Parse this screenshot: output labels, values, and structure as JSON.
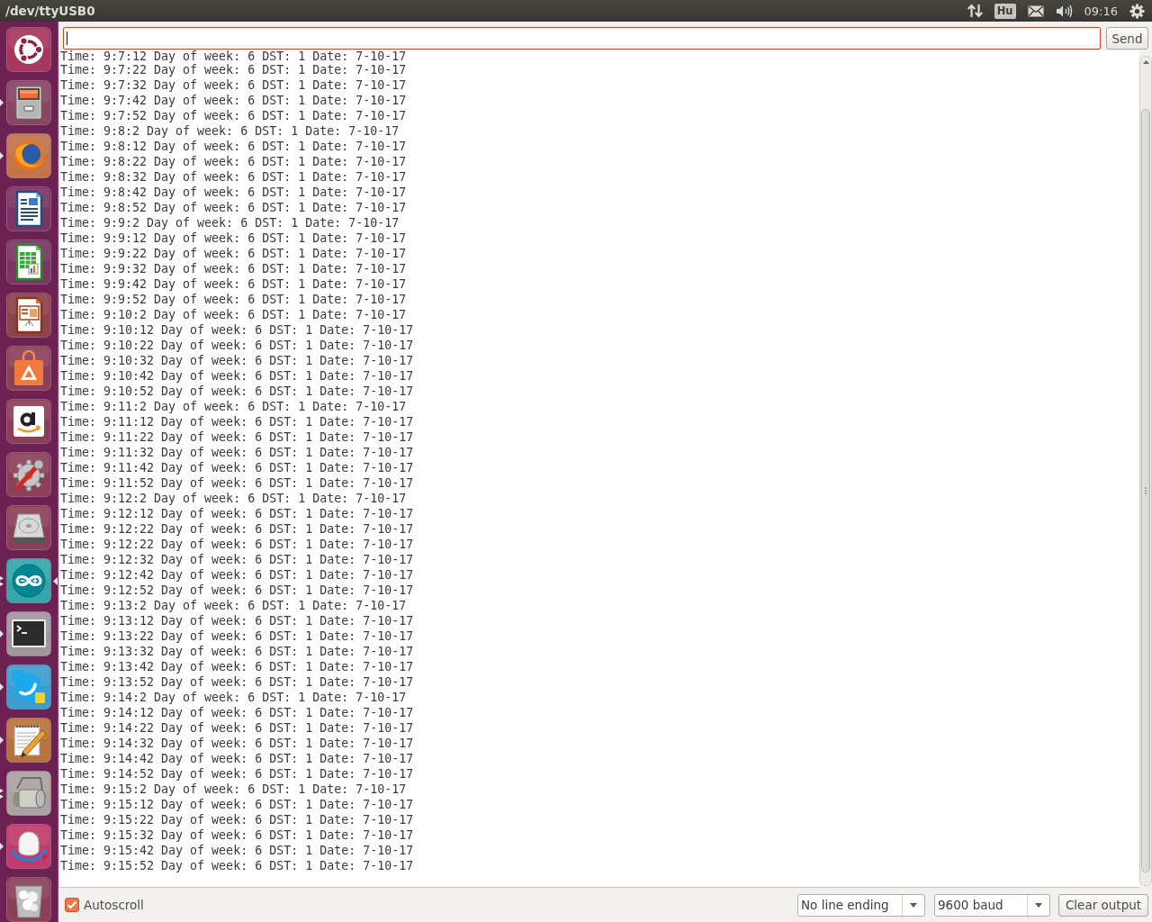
{
  "top_panel": {
    "title": "/dev/ttyUSB0",
    "keyboard_layout": "Hu",
    "clock": "09:16"
  },
  "launcher": {
    "items": [
      {
        "kind": "logo",
        "running": false,
        "multiple_windows": false,
        "focused": false
      },
      {
        "kind": "cabinet",
        "running": true,
        "multiple_windows": false,
        "focused": false
      },
      {
        "kind": "globe",
        "running": true,
        "multiple_windows": false,
        "focused": false
      },
      {
        "kind": "document",
        "running": false,
        "multiple_windows": false,
        "focused": false
      },
      {
        "kind": "spreadsheet",
        "running": false,
        "multiple_windows": false,
        "focused": false
      },
      {
        "kind": "presentation",
        "running": false,
        "multiple_windows": false,
        "focused": false
      },
      {
        "kind": "bag",
        "running": false,
        "multiple_windows": false,
        "focused": false
      },
      {
        "kind": "smile",
        "running": false,
        "multiple_windows": false,
        "focused": false
      },
      {
        "kind": "gear",
        "running": false,
        "multiple_windows": false,
        "focused": false
      },
      {
        "kind": "disk",
        "running": false,
        "multiple_windows": false,
        "focused": false
      },
      {
        "kind": "infinity",
        "running": true,
        "multiple_windows": true,
        "focused": true
      },
      {
        "kind": "terminal",
        "running": true,
        "multiple_windows": false,
        "focused": false
      },
      {
        "kind": "cloud",
        "running": true,
        "multiple_windows": false,
        "focused": false
      },
      {
        "kind": "notepad",
        "running": true,
        "multiple_windows": false,
        "focused": false
      },
      {
        "kind": "roller",
        "running": true,
        "multiple_windows": true,
        "focused": false
      },
      {
        "kind": "dome",
        "running": true,
        "multiple_windows": false,
        "focused": false
      },
      {
        "kind": "trash",
        "running": false,
        "multiple_windows": false,
        "focused": false
      }
    ]
  },
  "send_bar": {
    "message_field": {
      "focused": true
    },
    "send_button": "Send"
  },
  "output": {
    "lines": [
      "Time: 9:7:12 Day of week: 6 DST: 1 Date: 7-10-17",
      "Time: 9:7:22 Day of week: 6 DST: 1 Date: 7-10-17",
      "Time: 9:7:32 Day of week: 6 DST: 1 Date: 7-10-17",
      "Time: 9:7:42 Day of week: 6 DST: 1 Date: 7-10-17",
      "Time: 9:7:52 Day of week: 6 DST: 1 Date: 7-10-17",
      "Time: 9:8:2 Day of week: 6 DST: 1 Date: 7-10-17",
      "Time: 9:8:12 Day of week: 6 DST: 1 Date: 7-10-17",
      "Time: 9:8:22 Day of week: 6 DST: 1 Date: 7-10-17",
      "Time: 9:8:32 Day of week: 6 DST: 1 Date: 7-10-17",
      "Time: 9:8:42 Day of week: 6 DST: 1 Date: 7-10-17",
      "Time: 9:8:52 Day of week: 6 DST: 1 Date: 7-10-17",
      "Time: 9:9:2 Day of week: 6 DST: 1 Date: 7-10-17",
      "Time: 9:9:12 Day of week: 6 DST: 1 Date: 7-10-17",
      "Time: 9:9:22 Day of week: 6 DST: 1 Date: 7-10-17",
      "Time: 9:9:32 Day of week: 6 DST: 1 Date: 7-10-17",
      "Time: 9:9:42 Day of week: 6 DST: 1 Date: 7-10-17",
      "Time: 9:9:52 Day of week: 6 DST: 1 Date: 7-10-17",
      "Time: 9:10:2 Day of week: 6 DST: 1 Date: 7-10-17",
      "Time: 9:10:12 Day of week: 6 DST: 1 Date: 7-10-17",
      "Time: 9:10:22 Day of week: 6 DST: 1 Date: 7-10-17",
      "Time: 9:10:32 Day of week: 6 DST: 1 Date: 7-10-17",
      "Time: 9:10:42 Day of week: 6 DST: 1 Date: 7-10-17",
      "Time: 9:10:52 Day of week: 6 DST: 1 Date: 7-10-17",
      "Time: 9:11:2 Day of week: 6 DST: 1 Date: 7-10-17",
      "Time: 9:11:12 Day of week: 6 DST: 1 Date: 7-10-17",
      "Time: 9:11:22 Day of week: 6 DST: 1 Date: 7-10-17",
      "Time: 9:11:32 Day of week: 6 DST: 1 Date: 7-10-17",
      "Time: 9:11:42 Day of week: 6 DST: 1 Date: 7-10-17",
      "Time: 9:11:52 Day of week: 6 DST: 1 Date: 7-10-17",
      "Time: 9:12:2 Day of week: 6 DST: 1 Date: 7-10-17",
      "Time: 9:12:12 Day of week: 6 DST: 1 Date: 7-10-17",
      "Time: 9:12:22 Day of week: 6 DST: 1 Date: 7-10-17",
      "Time: 9:12:22 Day of week: 6 DST: 1 Date: 7-10-17",
      "Time: 9:12:32 Day of week: 6 DST: 1 Date: 7-10-17",
      "Time: 9:12:42 Day of week: 6 DST: 1 Date: 7-10-17",
      "Time: 9:12:52 Day of week: 6 DST: 1 Date: 7-10-17",
      "Time: 9:13:2 Day of week: 6 DST: 1 Date: 7-10-17",
      "Time: 9:13:12 Day of week: 6 DST: 1 Date: 7-10-17",
      "Time: 9:13:22 Day of week: 6 DST: 1 Date: 7-10-17",
      "Time: 9:13:32 Day of week: 6 DST: 1 Date: 7-10-17",
      "Time: 9:13:42 Day of week: 6 DST: 1 Date: 7-10-17",
      "Time: 9:13:52 Day of week: 6 DST: 1 Date: 7-10-17",
      "Time: 9:14:2 Day of week: 6 DST: 1 Date: 7-10-17",
      "Time: 9:14:12 Day of week: 6 DST: 1 Date: 7-10-17",
      "Time: 9:14:22 Day of week: 6 DST: 1 Date: 7-10-17",
      "Time: 9:14:32 Day of week: 6 DST: 1 Date: 7-10-17",
      "Time: 9:14:42 Day of week: 6 DST: 1 Date: 7-10-17",
      "Time: 9:14:52 Day of week: 6 DST: 1 Date: 7-10-17",
      "Time: 9:15:2 Day of week: 6 DST: 1 Date: 7-10-17",
      "Time: 9:15:12 Day of week: 6 DST: 1 Date: 7-10-17",
      "Time: 9:15:22 Day of week: 6 DST: 1 Date: 7-10-17",
      "Time: 9:15:32 Day of week: 6 DST: 1 Date: 7-10-17",
      "Time: 9:15:42 Day of week: 6 DST: 1 Date: 7-10-17",
      "Time: 9:15:52 Day of week: 6 DST: 1 Date: 7-10-17"
    ]
  },
  "footer": {
    "autoscroll": {
      "label": "Autoscroll",
      "checked": true
    },
    "line_ending": "No line ending",
    "baud_rate": "9600 baud",
    "clear_button": "Clear output"
  }
}
